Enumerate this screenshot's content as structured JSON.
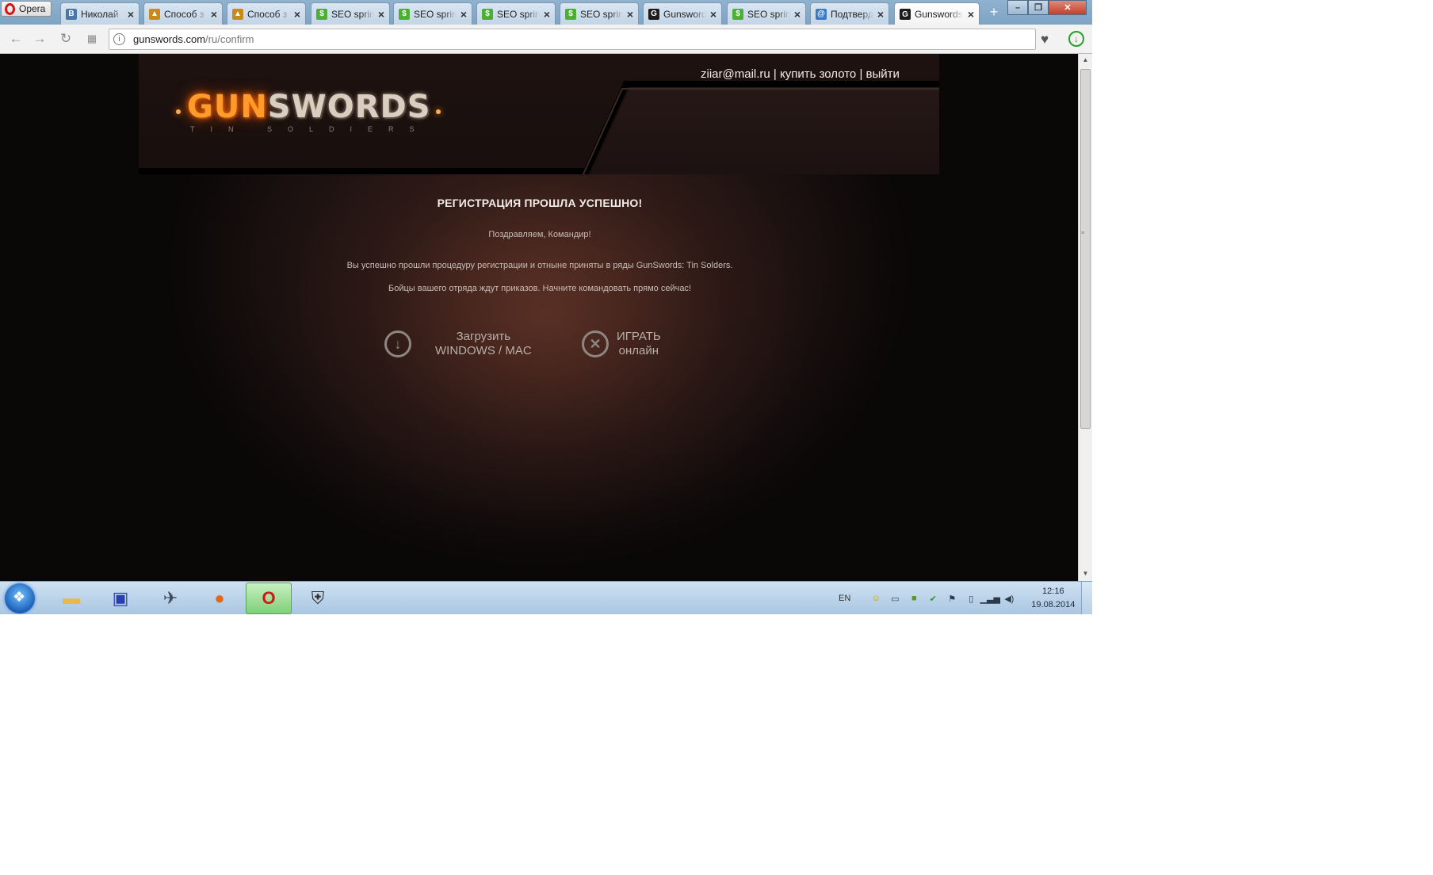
{
  "browser": {
    "menu_label": "Opera",
    "tabs": [
      {
        "title": "Николай",
        "favicon": "vk-icon",
        "color": "#4a76a8",
        "glyph": "В"
      },
      {
        "title": "Способ з",
        "favicon": "tank-icon",
        "color": "#c88a1a",
        "glyph": "▲"
      },
      {
        "title": "Способ з",
        "favicon": "tank-icon",
        "color": "#c88a1a",
        "glyph": "▲"
      },
      {
        "title": "SEO sprint",
        "favicon": "seosprint-icon",
        "color": "#4caf32",
        "glyph": "$"
      },
      {
        "title": "SEO sprint",
        "favicon": "seosprint-icon",
        "color": "#4caf32",
        "glyph": "$"
      },
      {
        "title": "SEO sprint",
        "favicon": "seosprint-icon",
        "color": "#4caf32",
        "glyph": "$"
      },
      {
        "title": "SEO sprint",
        "favicon": "seosprint-icon",
        "color": "#4caf32",
        "glyph": "$"
      },
      {
        "title": "Gunswords",
        "favicon": "gunswords-icon",
        "color": "#1c1c1c",
        "glyph": "G"
      },
      {
        "title": "SEO sprint",
        "favicon": "seosprint-icon",
        "color": "#4caf32",
        "glyph": "$"
      },
      {
        "title": "Подтверд",
        "favicon": "globe-icon",
        "color": "#3a78c8",
        "glyph": "@"
      },
      {
        "title": "Gunswords",
        "favicon": "gunswords-icon",
        "color": "#1c1c1c",
        "glyph": "G",
        "active": true
      }
    ],
    "url_host": "gunswords.com",
    "url_path": "/ru/confirm"
  },
  "page": {
    "user_email": "ziiar@mail.ru",
    "separator": " | ",
    "buy_gold": "купить золото",
    "logout": "выйти",
    "logo_gun": "GUN",
    "logo_swords": "SWORDS",
    "logo_sub": "TIN SOLDIERS",
    "title": "РЕГИСТРАЦИЯ ПРОШЛА УСПЕШНО!",
    "congrats": "Поздравляем, Командир!",
    "line1": "Вы успешно прошли процедуру регистрации и отныне приняты в ряды GunSwords: Tin Solders.",
    "line2": "Бойцы вашего отряда ждут приказов. Начните командовать прямо сейчас!",
    "download_line1": "Загрузить",
    "download_line2": "WINDOWS / MAC",
    "play_line1": "ИГРАТЬ",
    "play_line2": "онлайн"
  },
  "taskbar": {
    "lang": "EN",
    "time": "12:16",
    "date": "19.08.2014"
  }
}
